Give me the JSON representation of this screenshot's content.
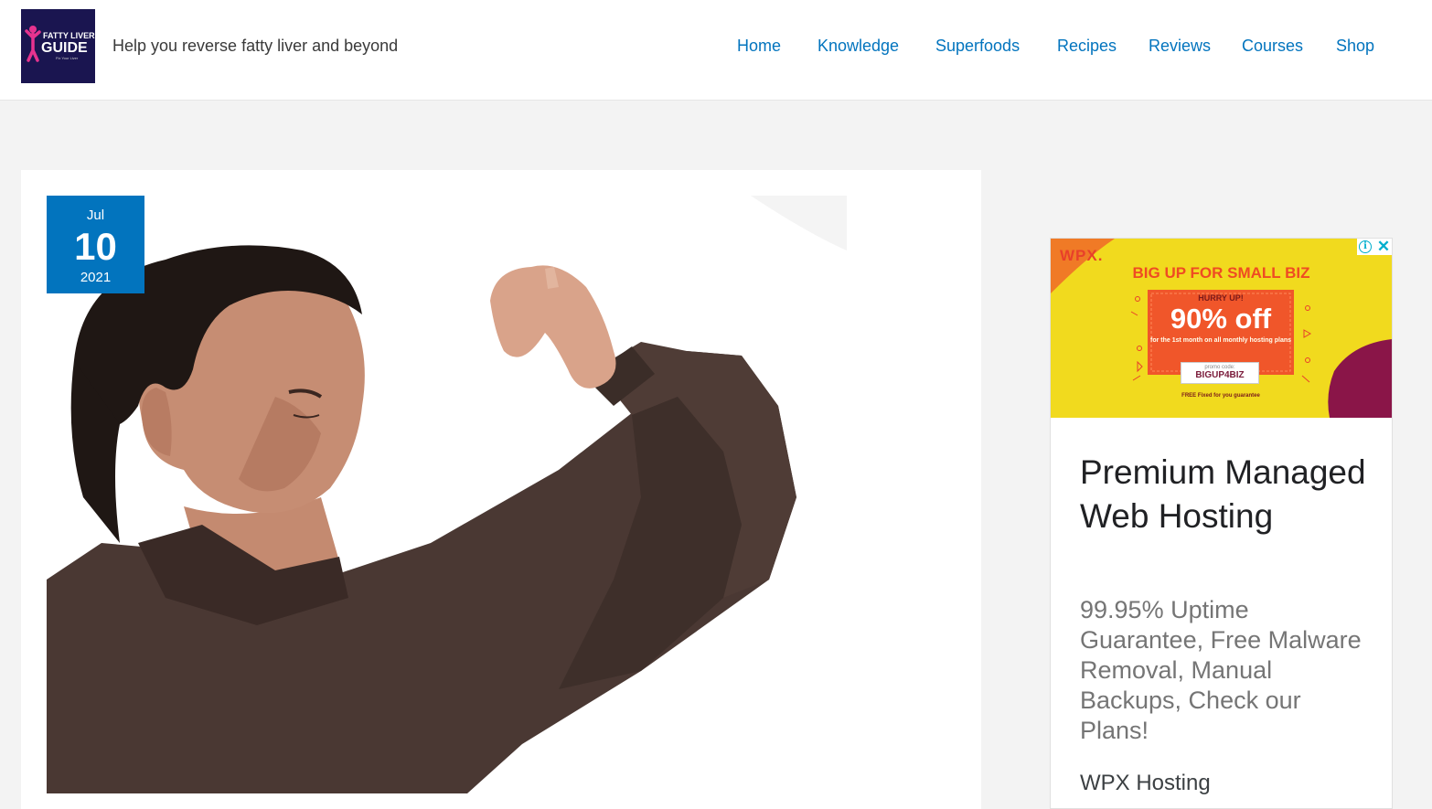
{
  "header": {
    "logo_alt": "Fatty Liver Guide",
    "logo_text_top": "FATTY LIVER",
    "logo_text_main": "GUIDE",
    "logo_text_sub": "Fix Your Liver",
    "tagline": "Help you reverse fatty liver and beyond"
  },
  "nav": {
    "items": [
      "Home",
      "Knowledge",
      "Superfoods",
      "Recipes",
      "Reviews",
      "Courses",
      "Shop"
    ]
  },
  "post": {
    "date": {
      "month": "Jul",
      "day": "10",
      "year": "2021"
    },
    "image_alt": "Man smelling his armpit"
  },
  "ad": {
    "banner": {
      "brand": "WPX.",
      "headline": "BIG UP FOR SMALL BIZ",
      "hurry": "HURRY UP!",
      "discount": "90% off",
      "subline": "for the 1st month on all monthly hosting plans",
      "promo_label": "promo code:",
      "promo_code": "BIGUP4BIZ",
      "guarantee": "FREE Fixed for you guarantee"
    },
    "title": "Premium Managed Web Hosting",
    "body": "99.95% Uptime Guarantee, Free Malware Removal, Manual Backups, Check our Plans!",
    "advertiser": "WPX Hosting",
    "colors": {
      "banner": "#f1da1e",
      "accent": "#ef4b23",
      "badge": "#0274be"
    }
  }
}
